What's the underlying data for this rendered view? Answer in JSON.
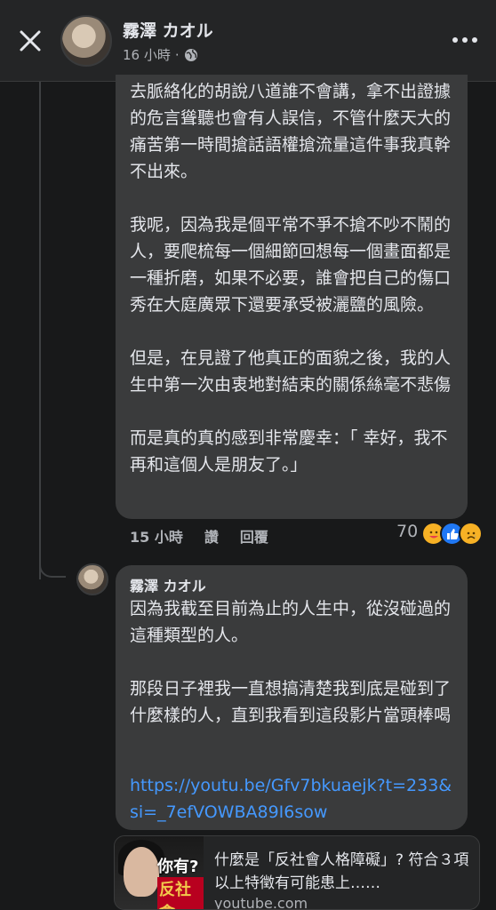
{
  "header": {
    "author_name": "霧澤 カオル",
    "time": "16 小時",
    "separator": "·",
    "close_icon": "close-icon",
    "privacy_icon": "globe-icon",
    "more_icon": "more-icon"
  },
  "comment1": {
    "text": "去脈絡化的胡說八道誰不會講，拿不出證據的危言聳聽也會有人誤信，不管什麼天大的痛苦第一時間搶話語權搶流量這件事我真幹不出來。\n\n我呢，因為我是個平常不爭不搶不吵不鬧的人，要爬梳每一個細節回想每一個畫面都是一種折磨，如果不必要，誰會把自己的傷口秀在大庭廣眾下還要承受被灑鹽的風險。\n\n但是，在見證了他真正的面貌之後，我的人生中第一次由衷地對結束的關係絲毫不悲傷\n\n而是真的真的感到非常慶幸：「 幸好，我不再和這個人是朋友了。」",
    "time": "15 小時",
    "like_label": "讚",
    "reply_label": "回覆",
    "reaction_count": "70",
    "reactions": [
      "care-icon",
      "like-icon",
      "sad-icon"
    ]
  },
  "reply": {
    "author_name": "霧澤 カオル",
    "text": "因為我截至目前為止的人生中，從沒碰過的這種類型的人。\n\n那段日子裡我一直想搞清楚我到底是碰到了什麼樣的人，直到我看到這段影片當頭棒喝",
    "link": "https://youtu.be/Gfv7bkuaejk?t=233&si=_7efVOWBA89I6sow",
    "preview": {
      "title": "什麼是「反社會人格障礙」? 符合３項以上特徵有可能患上……",
      "domain": "youtube.com",
      "thumb_text1": "你有?",
      "thumb_text2": "反社會"
    }
  },
  "colors": {
    "background": "#18191a",
    "bubble": "#3a3b3c",
    "link": "#4599ff",
    "secondary_text": "#b0b3b8"
  }
}
